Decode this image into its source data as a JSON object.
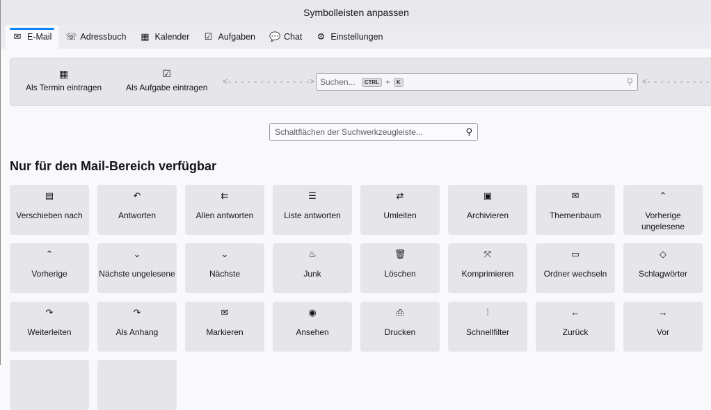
{
  "window": {
    "title": "Symbolleisten anpassen"
  },
  "tabs": [
    {
      "label": "E-Mail",
      "icon": "mail-icon",
      "glyph": "✉"
    },
    {
      "label": "Adressbuch",
      "icon": "address-book-icon",
      "glyph": "☏"
    },
    {
      "label": "Kalender",
      "icon": "calendar-icon",
      "glyph": "▦"
    },
    {
      "label": "Aufgaben",
      "icon": "tasks-icon",
      "glyph": "☑"
    },
    {
      "label": "Chat",
      "icon": "chat-icon",
      "glyph": "💬"
    },
    {
      "label": "Einstellungen",
      "icon": "gear-icon",
      "glyph": "⚙"
    }
  ],
  "toolbar": {
    "add_event": "Als Termin eintragen",
    "add_task": "Als Aufgabe eintragen",
    "spacer_right": "<- - - - - - - - - - - - ->",
    "spacer_left": "<- - - - - - - - - - - - -",
    "search_placeholder": "Suchen...",
    "kbd_ctrl": "CTRL",
    "kbd_plus": "+",
    "kbd_k": "K"
  },
  "palette_search": {
    "placeholder": "Schaltflächen der Suchwerkzeugleiste..."
  },
  "section_title": "Nur für den Mail-Bereich verfügbar",
  "buttons": [
    {
      "label": "Verschieben nach",
      "icon": "move-icon",
      "glyph": "▤"
    },
    {
      "label": "Antworten",
      "icon": "reply-icon",
      "glyph": "↶"
    },
    {
      "label": "Allen antworten",
      "icon": "reply-all-icon",
      "glyph": "⇇"
    },
    {
      "label": "Liste antworten",
      "icon": "reply-list-icon",
      "glyph": "☰"
    },
    {
      "label": "Umleiten",
      "icon": "redirect-icon",
      "glyph": "⇄"
    },
    {
      "label": "Archivieren",
      "icon": "archive-icon",
      "glyph": "▣"
    },
    {
      "label": "Themenbaum",
      "icon": "thread-icon",
      "glyph": "✉"
    },
    {
      "label": "Vorherige ungelesene",
      "icon": "previous-unread-icon",
      "glyph": "⌃"
    },
    {
      "label": "Vorherige",
      "icon": "previous-icon",
      "glyph": "⌃"
    },
    {
      "label": "Nächste ungelesene",
      "icon": "next-unread-icon",
      "glyph": "⌄"
    },
    {
      "label": "Nächste",
      "icon": "next-icon",
      "glyph": "⌄"
    },
    {
      "label": "Junk",
      "icon": "junk-icon",
      "glyph": "♨"
    },
    {
      "label": "Löschen",
      "icon": "trash-icon",
      "glyph": "🗑"
    },
    {
      "label": "Komprimieren",
      "icon": "compact-icon",
      "glyph": "⤧"
    },
    {
      "label": "Ordner wechseln",
      "icon": "folder-icon",
      "glyph": "▭"
    },
    {
      "label": "Schlagwörter",
      "icon": "tag-icon",
      "glyph": "◇"
    },
    {
      "label": "Weiterleiten",
      "icon": "forward-icon",
      "glyph": "↷"
    },
    {
      "label": "Als Anhang",
      "icon": "forward-attachment-icon",
      "glyph": "↷"
    },
    {
      "label": "Markieren",
      "icon": "mark-icon",
      "glyph": "✉"
    },
    {
      "label": "Ansehen",
      "icon": "view-icon",
      "glyph": "◉"
    },
    {
      "label": "Drucken",
      "icon": "print-icon",
      "glyph": "⎙"
    },
    {
      "label": "Schnellfilter",
      "icon": "filter-icon",
      "glyph": "⫶"
    },
    {
      "label": "Zurück",
      "icon": "back-icon",
      "glyph": "←"
    },
    {
      "label": "Vor",
      "icon": "forward-arrow-icon",
      "glyph": "→"
    },
    {
      "label": "",
      "icon": "",
      "glyph": ""
    },
    {
      "label": "",
      "icon": "",
      "glyph": ""
    }
  ]
}
